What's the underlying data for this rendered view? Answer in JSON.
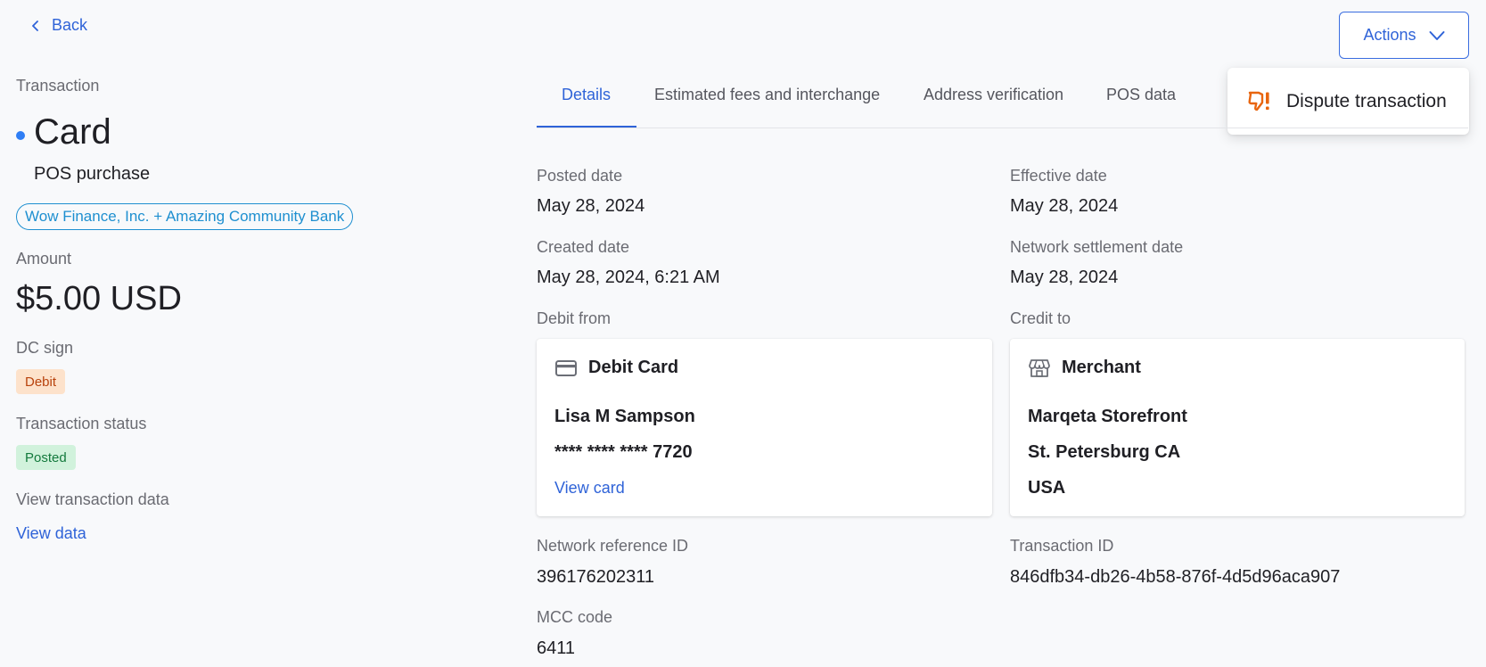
{
  "nav": {
    "back_label": "Back"
  },
  "actions": {
    "button_label": "Actions",
    "menu_items": [
      {
        "label": "Dispute transaction",
        "icon": "thumbs-down-icon"
      }
    ]
  },
  "summary": {
    "section_label": "Transaction",
    "type": "Card",
    "subtype": "POS purchase",
    "program": "Wow Finance, Inc. + Amazing Community Bank",
    "amount_label": "Amount",
    "amount": "$5.00 USD",
    "dc_sign_label": "DC sign",
    "dc_sign": "Debit",
    "status_label": "Transaction status",
    "status": "Posted",
    "view_data_label": "View transaction data",
    "view_data_link": "View data"
  },
  "tabs": [
    {
      "label": "Details",
      "active": true
    },
    {
      "label": "Estimated fees and interchange",
      "active": false
    },
    {
      "label": "Address verification",
      "active": false
    },
    {
      "label": "POS data",
      "active": false
    }
  ],
  "details": {
    "posted_date": {
      "label": "Posted date",
      "value": "May 28, 2024"
    },
    "effective_date": {
      "label": "Effective date",
      "value": "May 28, 2024"
    },
    "created_date": {
      "label": "Created date",
      "value": "May 28, 2024, 6:21 AM"
    },
    "network_settlement_date": {
      "label": "Network settlement date",
      "value": "May 28, 2024"
    },
    "debit_from": {
      "label": "Debit from",
      "title": "Debit Card",
      "icon": "credit-card-icon",
      "name": "Lisa M Sampson",
      "card_number": "**** **** **** 7720",
      "link": "View card"
    },
    "credit_to": {
      "label": "Credit to",
      "title": "Merchant",
      "icon": "storefront-icon",
      "name": "Marqeta Storefront",
      "city": "St. Petersburg CA",
      "country": "USA"
    },
    "network_reference_id": {
      "label": "Network reference ID",
      "value": "396176202311"
    },
    "transaction_id": {
      "label": "Transaction ID",
      "value": "846dfb34-db26-4b58-876f-4d5d96aca907"
    },
    "mcc_code": {
      "label": "MCC code",
      "value": "6411"
    }
  },
  "colors": {
    "accent": "#2f63d8",
    "debit_badge_bg": "#fde2cb",
    "posted_badge_bg": "#d1f2dc",
    "dispute_icon": "#e8650f",
    "status_dot": "#2f7ef5"
  }
}
